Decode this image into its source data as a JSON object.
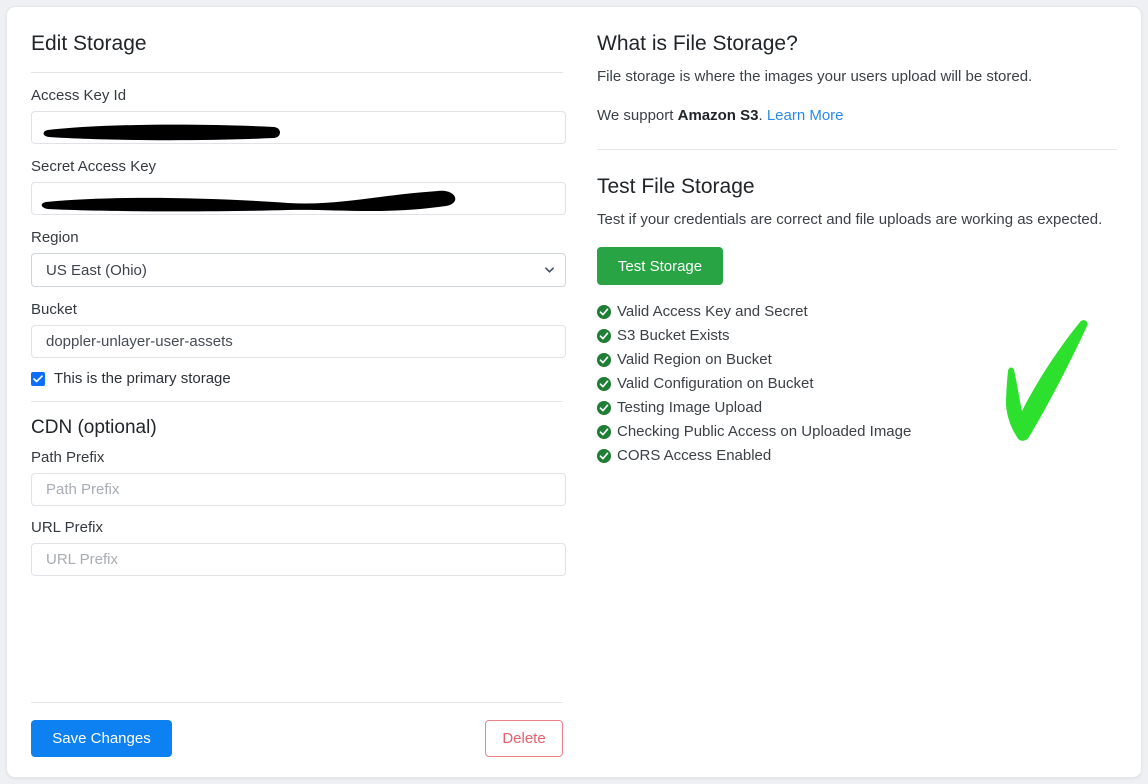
{
  "colors": {
    "primary": "#0d80f2",
    "danger": "#e4606d",
    "success": "#28a444",
    "link": "#2b8ae8",
    "check_icon": "#1e7e34",
    "annotation_green": "#2ee02e",
    "checkbox_blue": "#0d6efd",
    "page_background": "#eef0f3",
    "card_background": "#ffffff"
  },
  "left": {
    "title": "Edit Storage",
    "fields": {
      "access_key_id": {
        "label": "Access Key Id",
        "value": "",
        "redacted": true
      },
      "secret_access_key": {
        "label": "Secret Access Key",
        "value": "",
        "redacted": true
      },
      "region": {
        "label": "Region",
        "selected": "US East (Ohio)",
        "icon": "chevron-down-icon"
      },
      "bucket": {
        "label": "Bucket",
        "value": "doppler-unlayer-user-assets"
      }
    },
    "primary_storage_checkbox": {
      "label": "This is the primary storage",
      "checked": true
    },
    "cdn": {
      "title": "CDN (optional)",
      "path_prefix": {
        "label": "Path Prefix",
        "value": "",
        "placeholder": "Path Prefix"
      },
      "url_prefix": {
        "label": "URL Prefix",
        "value": "",
        "placeholder": "URL Prefix"
      }
    },
    "save_label": "Save Changes",
    "delete_label": "Delete"
  },
  "right": {
    "what_is": {
      "title": "What is File Storage?",
      "description": "File storage is where the images your users upload will be stored.",
      "support_prefix": "We support ",
      "support_bold": "Amazon S3",
      "support_suffix": ". ",
      "learn_more": "Learn More"
    },
    "test": {
      "title": "Test File Storage",
      "description": "Test if your credentials are correct and file uploads are working as expected.",
      "button_label": "Test Storage",
      "results": [
        {
          "label": "Valid Access Key and Secret",
          "icon": "check-circle-icon",
          "status": "pass"
        },
        {
          "label": "S3 Bucket Exists",
          "icon": "check-circle-icon",
          "status": "pass"
        },
        {
          "label": "Valid Region on Bucket",
          "icon": "check-circle-icon",
          "status": "pass"
        },
        {
          "label": "Valid Configuration on Bucket",
          "icon": "check-circle-icon",
          "status": "pass"
        },
        {
          "label": "Testing Image Upload",
          "icon": "check-circle-icon",
          "status": "pass"
        },
        {
          "label": "Checking Public Access on Uploaded Image",
          "icon": "check-circle-icon",
          "status": "pass"
        },
        {
          "label": "CORS Access Enabled",
          "icon": "check-circle-icon",
          "status": "pass"
        }
      ]
    },
    "annotation": {
      "icon": "green-checkmark-annotation-icon"
    }
  }
}
